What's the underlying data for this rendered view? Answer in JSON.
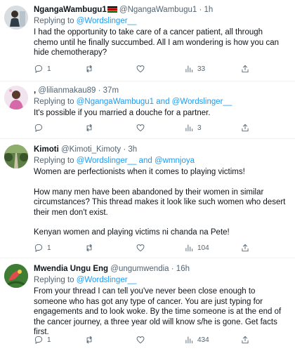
{
  "tweets": [
    {
      "name": "NgangaWambugu1",
      "handle": "@NgangaWambugu1",
      "dot": "·",
      "time": "1h",
      "reply_prefix": "Replying to ",
      "mention1": "@Wordslinger__",
      "mention_joiner": "",
      "mention2": "",
      "paragraphs": [
        "I had the opportunity to take care of a cancer patient, all through chemo until he finally succumbed. All I am wondering is how you can hide chemotherapy?"
      ],
      "counts": {
        "replies": "1",
        "retweets": "",
        "likes": "",
        "views": "33"
      }
    },
    {
      "name": ",",
      "handle": "@lilianmakau89",
      "dot": "·",
      "time": "37m",
      "reply_prefix": "Replying to ",
      "mention1": "@NgangaWambugu1",
      "mention_joiner": " and ",
      "mention2": "@Wordslinger__",
      "paragraphs": [
        "It's possible if you married a douche for a partner."
      ],
      "counts": {
        "replies": "",
        "retweets": "",
        "likes": "",
        "views": "3"
      }
    },
    {
      "name": "Kimoti",
      "handle": "@Kimoti_Kimoty",
      "dot": "·",
      "time": "3h",
      "reply_prefix": "Replying to ",
      "mention1": "@Wordslinger__",
      "mention_joiner": " and ",
      "mention2": "@wmnjoya",
      "paragraphs": [
        "Women are perfectionists when it comes to playing victims!",
        "How many men have been abandoned by their women in similar circumstances? This thread makes it look like such women who desert their men don't exist.",
        "Kenyan women and playing victims ni chanda na Pete!"
      ],
      "counts": {
        "replies": "1",
        "retweets": "",
        "likes": "",
        "views": "104"
      }
    },
    {
      "name": "Mwendia Ungu Eng",
      "handle": "@ungumwendia",
      "dot": "·",
      "time": "16h",
      "reply_prefix": "Replying to ",
      "mention1": "@Wordslinger__",
      "mention_joiner": "",
      "mention2": "",
      "paragraphs": [
        "From your thread I can tell you've never been close enough to someone who has got any type of cancer. You are just typing for engagements and to look woke. By the time someone is at the end of the cancer journey, a three year old will know s/he is gone. Get facts first."
      ],
      "counts": {
        "replies": "1",
        "retweets": "",
        "likes": "",
        "views": "434"
      }
    }
  ],
  "icons": {
    "reply": "reply-icon",
    "retweet": "retweet-icon",
    "like": "heart-icon",
    "views": "views-icon",
    "share": "share-icon",
    "flag": "kenya-flag-icon"
  },
  "colors": {
    "link": "#1d9bf0",
    "secondary_text": "#536471",
    "primary_text": "#0f1419"
  }
}
